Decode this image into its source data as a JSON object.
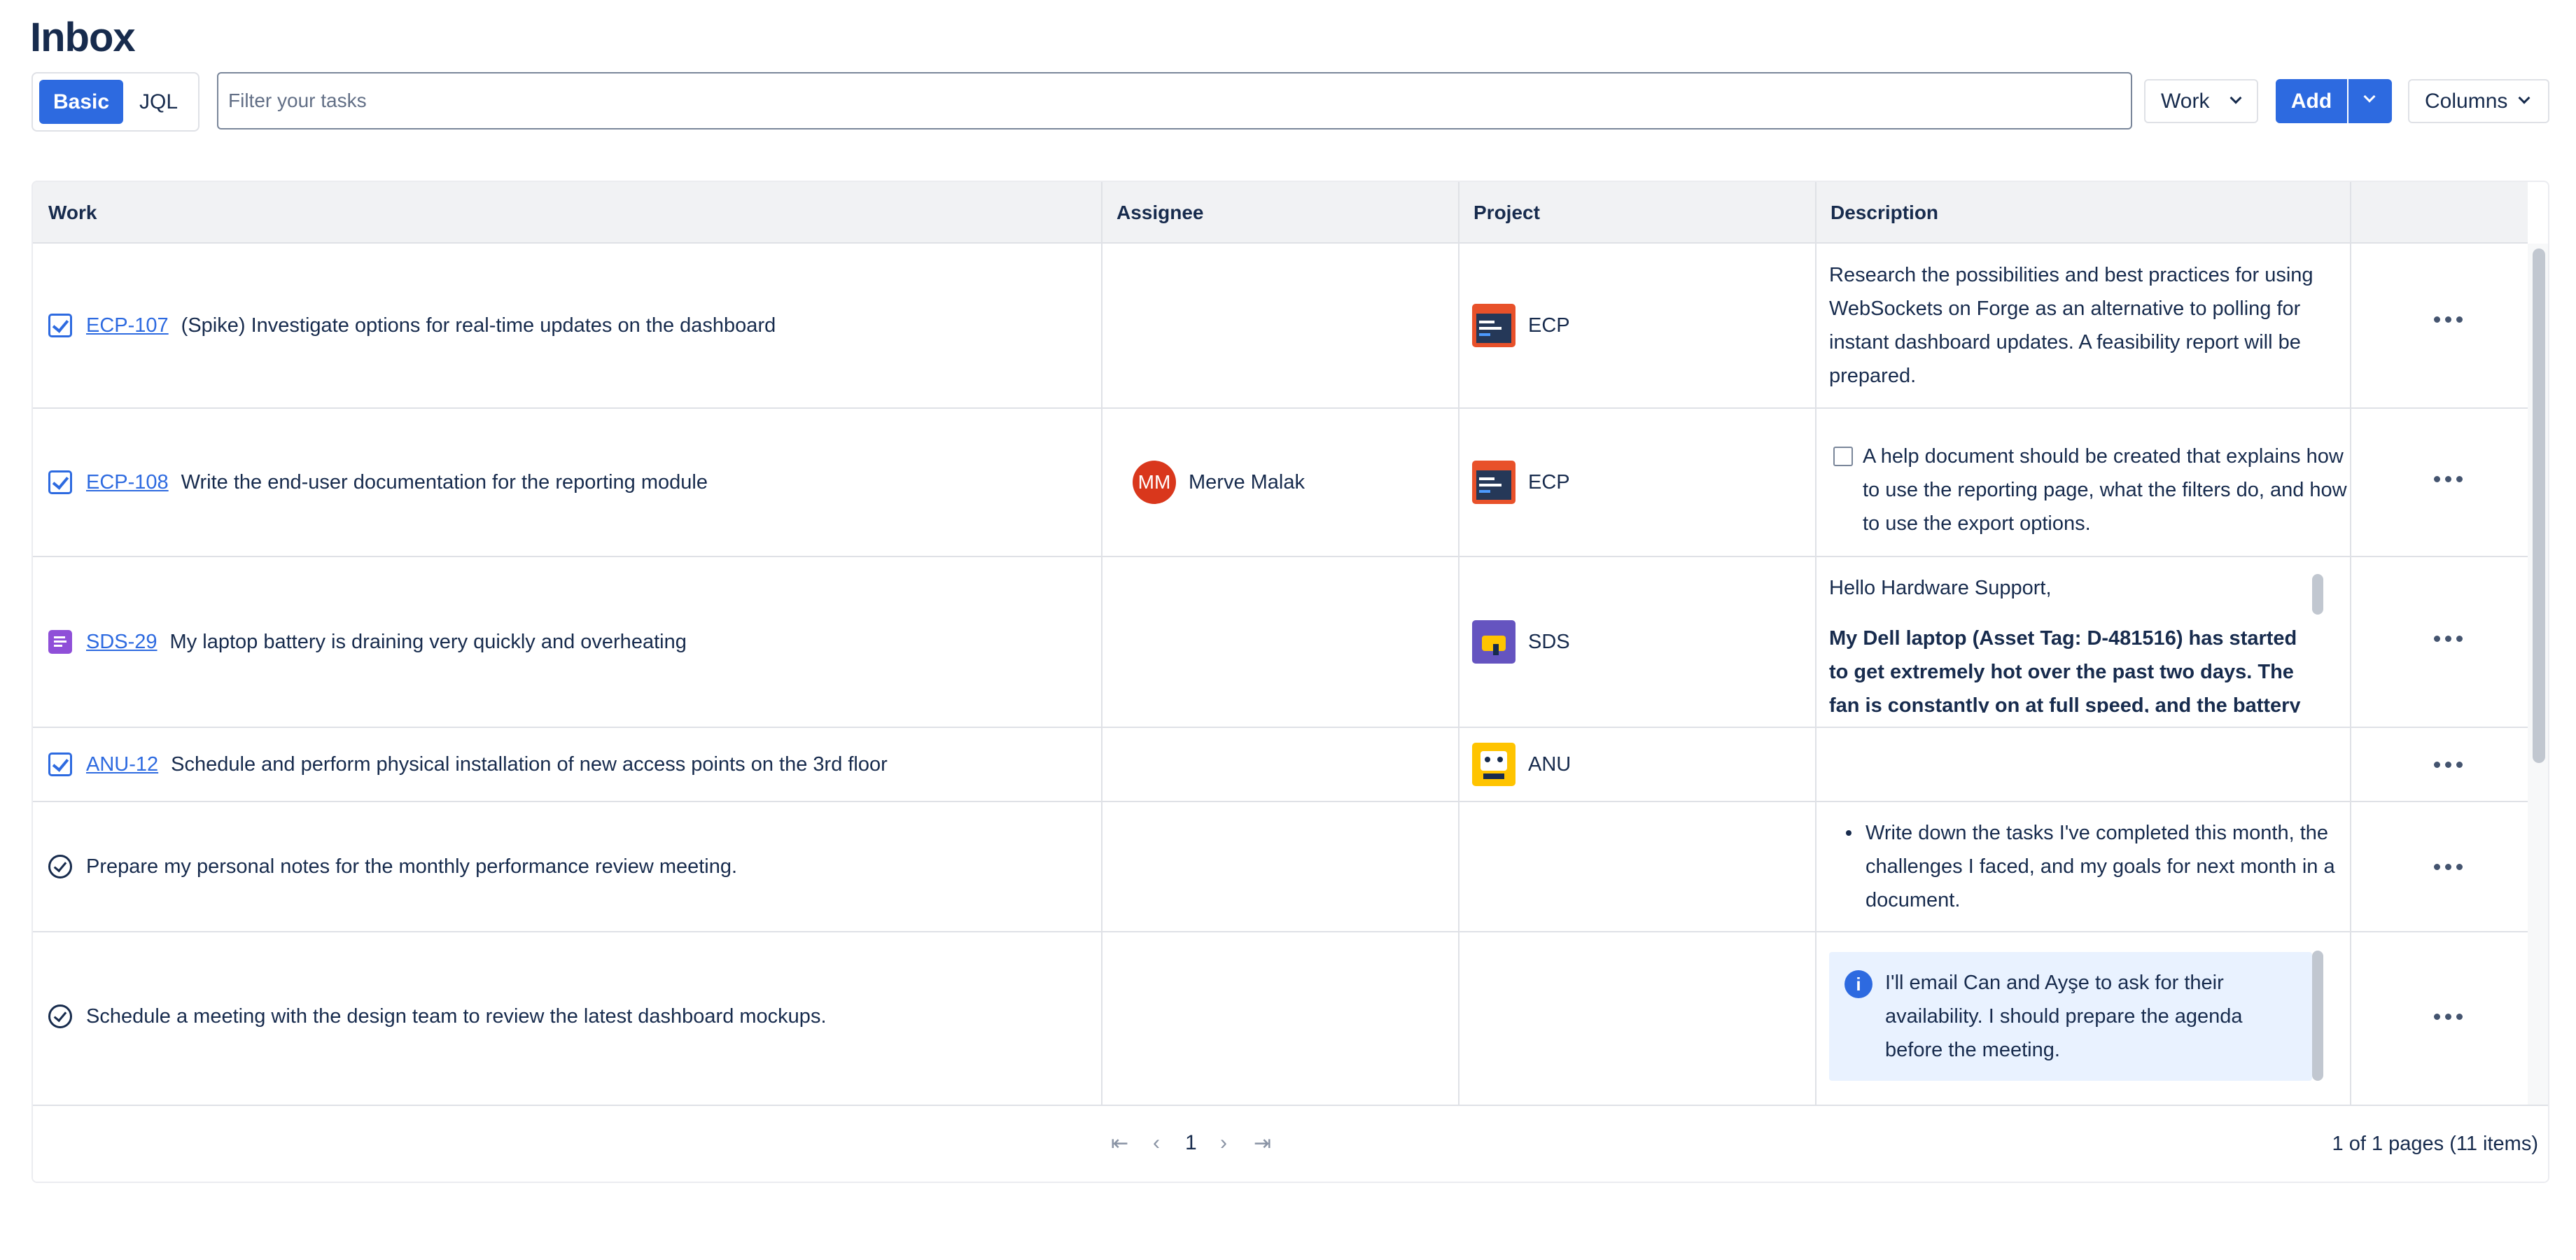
{
  "page": {
    "title": "Inbox"
  },
  "toolbar": {
    "mode_basic": "Basic",
    "mode_jql": "JQL",
    "filter_placeholder": "Filter your tasks",
    "work_label": "Work",
    "add_label": "Add",
    "columns_label": "Columns"
  },
  "table": {
    "headers": [
      "Work",
      "Assignee",
      "Project",
      "Description"
    ],
    "rows": [
      {
        "key": "ECP-107",
        "summary": "(Spike) Investigate options for real-time updates on the dashboard",
        "assignee": "",
        "project": "ECP",
        "description": "Research the possibilities and best practices for using WebSockets on Forge as an alternative to polling for instant dashboard updates. A feasibility report will be prepared."
      },
      {
        "key": "ECP-108",
        "summary": "Write the end-user documentation for the reporting module",
        "assignee_initials": "MM",
        "assignee": "Merve Malak",
        "project": "ECP",
        "description": "A help document should be created that explains how to use the reporting page, what the filters do, and how to use the export options."
      },
      {
        "key": "SDS-29",
        "summary": "My laptop battery is draining very quickly and overheating",
        "assignee": "",
        "project": "SDS",
        "description_greeting": "Hello Hardware Support,",
        "description": "My Dell laptop (Asset Tag: D-481516) has started to get extremely hot over the past two days. The fan is constantly on at full speed, and the battery"
      },
      {
        "key": "ANU-12",
        "summary": "Schedule and perform physical installation of new access points on the 3rd floor",
        "assignee": "",
        "project": "ANU",
        "description": ""
      },
      {
        "key": "",
        "summary": "Prepare my personal notes for the monthly performance review meeting.",
        "assignee": "",
        "project": "",
        "description": "Write down the tasks I've completed this month, the challenges I faced, and my goals for next month in a document."
      },
      {
        "key": "",
        "summary": "Schedule a meeting with the design team to review the latest dashboard mockups.",
        "assignee": "",
        "project": "",
        "description": "I'll email Can and Ayşe to ask for their availability. I should prepare the agenda before the meeting."
      }
    ]
  },
  "pagination": {
    "current_page": "1",
    "summary": "1 of 1 pages (11 items)"
  },
  "colors": {
    "accent": "#2d6ae0",
    "avatar": "#d9371c",
    "sds_icon": "#8f4fd8"
  }
}
